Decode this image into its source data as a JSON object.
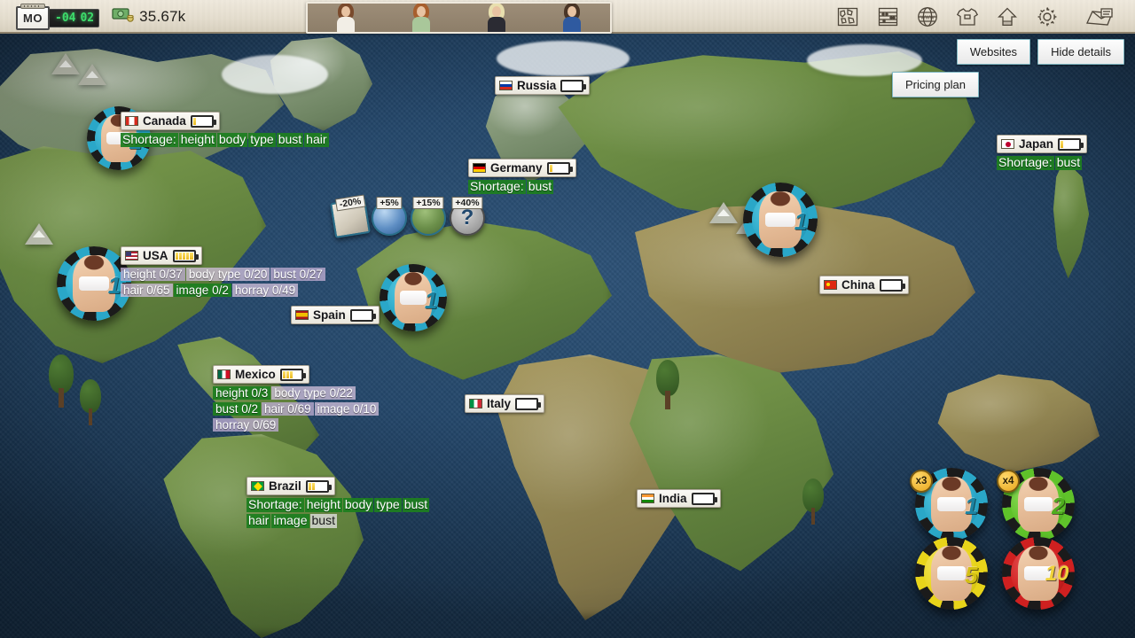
{
  "topbar": {
    "calendar": {
      "day_label": "MO",
      "led_left": "-04",
      "led_right": "02",
      "icon": "calendar-icon"
    },
    "cash": {
      "icon": "money-icon",
      "amount": "35.67k"
    },
    "icons": [
      {
        "name": "world-map-icon",
        "label": "Map"
      },
      {
        "name": "ledger-icon",
        "label": "Accounting"
      },
      {
        "name": "www-globe-icon",
        "label": "Websites"
      },
      {
        "name": "tshirt-icon",
        "label": "Clothing"
      },
      {
        "name": "upgrade-arrow-icon",
        "label": "Upgrade"
      },
      {
        "name": "gear-icon",
        "label": "Settings"
      }
    ],
    "mail_icon": "mail-icon",
    "portraits": [
      {
        "name": "portrait-1",
        "hair": "#7a4a2c",
        "outfit": "#f2eee6"
      },
      {
        "name": "portrait-2",
        "hair": "#a85f2d",
        "outfit": "#a9c79a"
      },
      {
        "name": "portrait-3",
        "hair": "#e8dfae",
        "outfit": "#2b2b33"
      },
      {
        "name": "portrait-4",
        "hair": "#4a3526",
        "outfit": "#2f5aa0"
      }
    ]
  },
  "buttons": {
    "websites": "Websites",
    "hide_details": "Hide details",
    "pricing_plan": "Pricing plan"
  },
  "countries": [
    {
      "name": "Canada",
      "flag_colors": [
        "#d52b1e",
        "#ffffff",
        "#d52b1e"
      ],
      "flag_type": "vertical",
      "battery_total": 5,
      "battery_filled": 1,
      "shortage_label": "Shortage:",
      "shortage_items": [
        "height",
        "body",
        "type",
        "bust",
        "hair"
      ],
      "stats": []
    },
    {
      "name": "USA",
      "flag_colors": [
        "#3c3b6e",
        "#b22234",
        "#ffffff"
      ],
      "flag_type": "usa",
      "battery_total": 5,
      "battery_filled": 5,
      "shortage_label": "",
      "shortage_items": [],
      "stats": [
        {
          "text": "height 0/37",
          "style": "lav"
        },
        {
          "text": "body type 0/20",
          "style": "lav2"
        },
        {
          "text": "bust 0/27",
          "style": "lav"
        },
        {
          "text": "hair 0/65",
          "style": "lav2"
        },
        {
          "text": "image 0/2",
          "style": "grn"
        },
        {
          "text": "horray 0/49",
          "style": "lav2"
        }
      ]
    },
    {
      "name": "Mexico",
      "flag_colors": [
        "#006847",
        "#ffffff",
        "#ce1126"
      ],
      "flag_type": "vertical",
      "battery_total": 5,
      "battery_filled": 3,
      "shortage_label": "",
      "shortage_items": [],
      "stats": [
        {
          "text": "height 0/3",
          "style": "grn"
        },
        {
          "text": "body type 0/22",
          "style": "lav2"
        },
        {
          "text": "bust 0/2",
          "style": "grn"
        },
        {
          "text": "hair 0/69",
          "style": "lav"
        },
        {
          "text": "image 0/10",
          "style": "lav2"
        },
        {
          "text": "horray 0/69",
          "style": "lav"
        }
      ]
    },
    {
      "name": "Brazil",
      "flag_colors": [
        "#009c3b",
        "#ffdf00",
        "#002776"
      ],
      "flag_type": "brazil",
      "battery_total": 5,
      "battery_filled": 2,
      "shortage_label": "Shortage:",
      "shortage_items": [
        "height",
        "body",
        "type",
        "bust",
        "hair",
        "image",
        "bust"
      ],
      "stats": []
    },
    {
      "name": "Russia",
      "flag_colors": [
        "#ffffff",
        "#0039a6",
        "#d52b1e"
      ],
      "flag_type": "horizontal",
      "battery_total": 5,
      "battery_filled": 0,
      "shortage_label": "",
      "shortage_items": [],
      "stats": []
    },
    {
      "name": "Germany",
      "flag_colors": [
        "#000000",
        "#dd0000",
        "#ffce00"
      ],
      "flag_type": "horizontal",
      "battery_total": 5,
      "battery_filled": 1,
      "shortage_label": "Shortage:",
      "shortage_items": [
        "bust"
      ],
      "stats": []
    },
    {
      "name": "Spain",
      "flag_colors": [
        "#aa151b",
        "#f1bf00",
        "#aa151b"
      ],
      "flag_type": "horizontal",
      "battery_total": 5,
      "battery_filled": 0,
      "shortage_label": "",
      "shortage_items": [],
      "stats": []
    },
    {
      "name": "Italy",
      "flag_colors": [
        "#009246",
        "#ffffff",
        "#ce2b37"
      ],
      "flag_type": "vertical",
      "battery_total": 5,
      "battery_filled": 0,
      "shortage_label": "",
      "shortage_items": [],
      "stats": []
    },
    {
      "name": "China",
      "flag_colors": [
        "#de2910",
        "#ffde00",
        "#de2910"
      ],
      "flag_type": "china",
      "battery_total": 5,
      "battery_filled": 0,
      "shortage_label": "",
      "shortage_items": [],
      "stats": []
    },
    {
      "name": "India",
      "flag_colors": [
        "#ff9933",
        "#ffffff",
        "#138808"
      ],
      "flag_type": "horizontal",
      "battery_total": 5,
      "battery_filled": 0,
      "shortage_label": "",
      "shortage_items": [],
      "stats": []
    },
    {
      "name": "Japan",
      "flag_colors": [
        "#ffffff",
        "#bc002d",
        "#ffffff"
      ],
      "flag_type": "japan",
      "battery_total": 5,
      "battery_filled": 1,
      "shortage_label": "Shortage:",
      "shortage_items": [
        "bust"
      ],
      "stats": []
    }
  ],
  "bonus_tokens": [
    {
      "name": "bonus-token-penalty",
      "pct": "-20%",
      "kind": "paper",
      "shape": "square"
    },
    {
      "name": "bonus-token-book",
      "pct": "+5%",
      "kind": "book",
      "shape": "round"
    },
    {
      "name": "bonus-token-house",
      "pct": "+15%",
      "kind": "house",
      "shape": "round"
    },
    {
      "name": "bonus-token-mystery",
      "pct": "+40%",
      "kind": "mystery",
      "shape": "round"
    }
  ],
  "map_chips": [
    {
      "name": "map-chip-canada",
      "value": "1",
      "color": "#2aa7c8",
      "multiplier": ""
    },
    {
      "name": "map-chip-usa",
      "value": "1",
      "color": "#2aa7c8",
      "multiplier": ""
    },
    {
      "name": "map-chip-europe",
      "value": "1",
      "color": "#2aa7c8",
      "multiplier": ""
    },
    {
      "name": "map-chip-asia",
      "value": "1",
      "color": "#2aa7c8",
      "multiplier": ""
    }
  ],
  "tray_chips": [
    {
      "name": "tray-chip-1",
      "value": "1",
      "color": "#2aa7c8",
      "num_color": "#1b84a3",
      "multiplier": "x3"
    },
    {
      "name": "tray-chip-2",
      "value": "2",
      "color": "#5fc22a",
      "num_color": "#4fae1f",
      "multiplier": "x4"
    },
    {
      "name": "tray-chip-5",
      "value": "5",
      "color": "#e8d41a",
      "num_color": "#d4c014",
      "multiplier": ""
    },
    {
      "name": "tray-chip-10",
      "value": "10",
      "color": "#cf2020",
      "num_color": "#f0d23a",
      "multiplier": ""
    }
  ]
}
